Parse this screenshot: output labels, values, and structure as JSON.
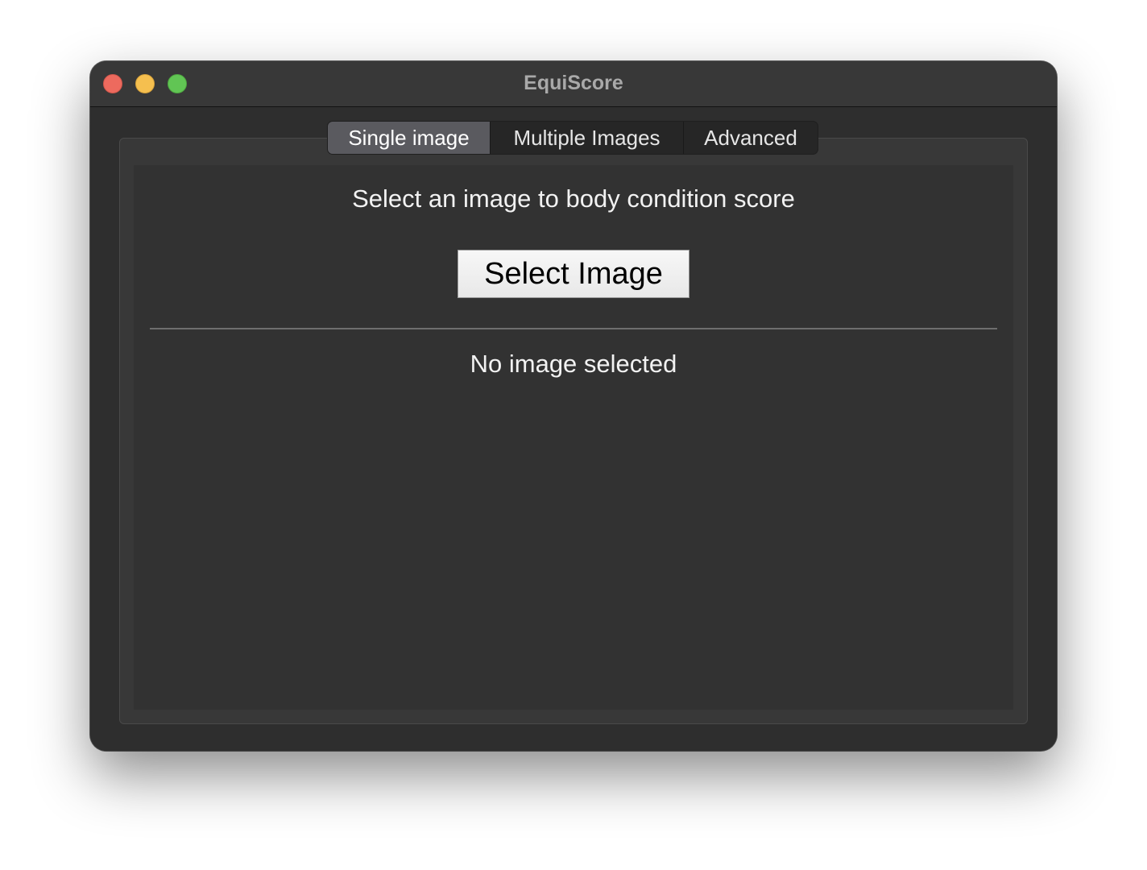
{
  "window": {
    "title": "EquiScore"
  },
  "tabs": [
    {
      "label": "Single image",
      "selected": true
    },
    {
      "label": "Multiple Images",
      "selected": false
    },
    {
      "label": "Advanced",
      "selected": false
    }
  ],
  "single_image": {
    "prompt": "Select an image to body condition score",
    "select_button_label": "Select Image",
    "status_text": "No image selected"
  },
  "colors": {
    "close": "#ed6a5e",
    "minimize": "#f5bf4f",
    "zoom": "#61c554",
    "selected_tab": "#5a5a5f"
  }
}
